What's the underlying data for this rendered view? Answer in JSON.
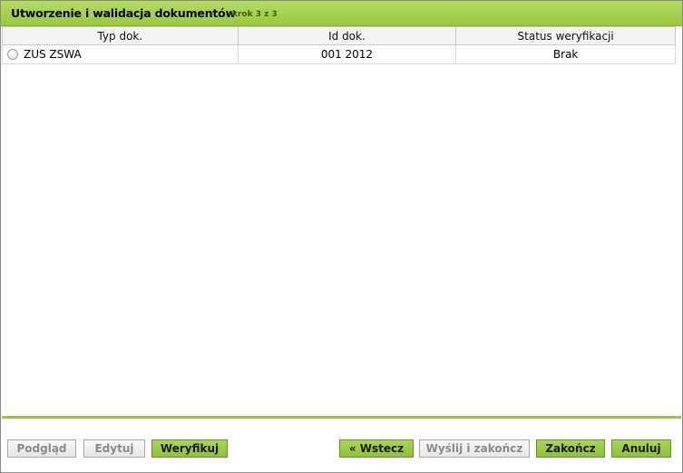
{
  "header": {
    "title": "Utworzenie i walidacja dokumentów",
    "step": "krok 3 z 3"
  },
  "table": {
    "columns": [
      "Typ dok.",
      "Id dok.",
      "Status weryfikacji"
    ],
    "rows": [
      {
        "type": "ZUS ZSWA",
        "id": "001 2012",
        "status": "Brak",
        "selected": false
      }
    ]
  },
  "buttons": {
    "preview": {
      "label": "Podgląd",
      "enabled": false
    },
    "edit": {
      "label": "Edytuj",
      "enabled": false
    },
    "verify": {
      "label": "Weryfikuj",
      "enabled": true
    },
    "back": {
      "label": "« Wstecz",
      "enabled": true
    },
    "send_finish": {
      "label": "Wyślij i zakończ",
      "enabled": false
    },
    "finish": {
      "label": "Zakończ",
      "enabled": true
    },
    "cancel": {
      "label": "Anuluj",
      "enabled": true
    }
  },
  "colors": {
    "accent": "#98c93b",
    "button_enabled": "#9acd47",
    "button_disabled": "#eeeeee"
  }
}
